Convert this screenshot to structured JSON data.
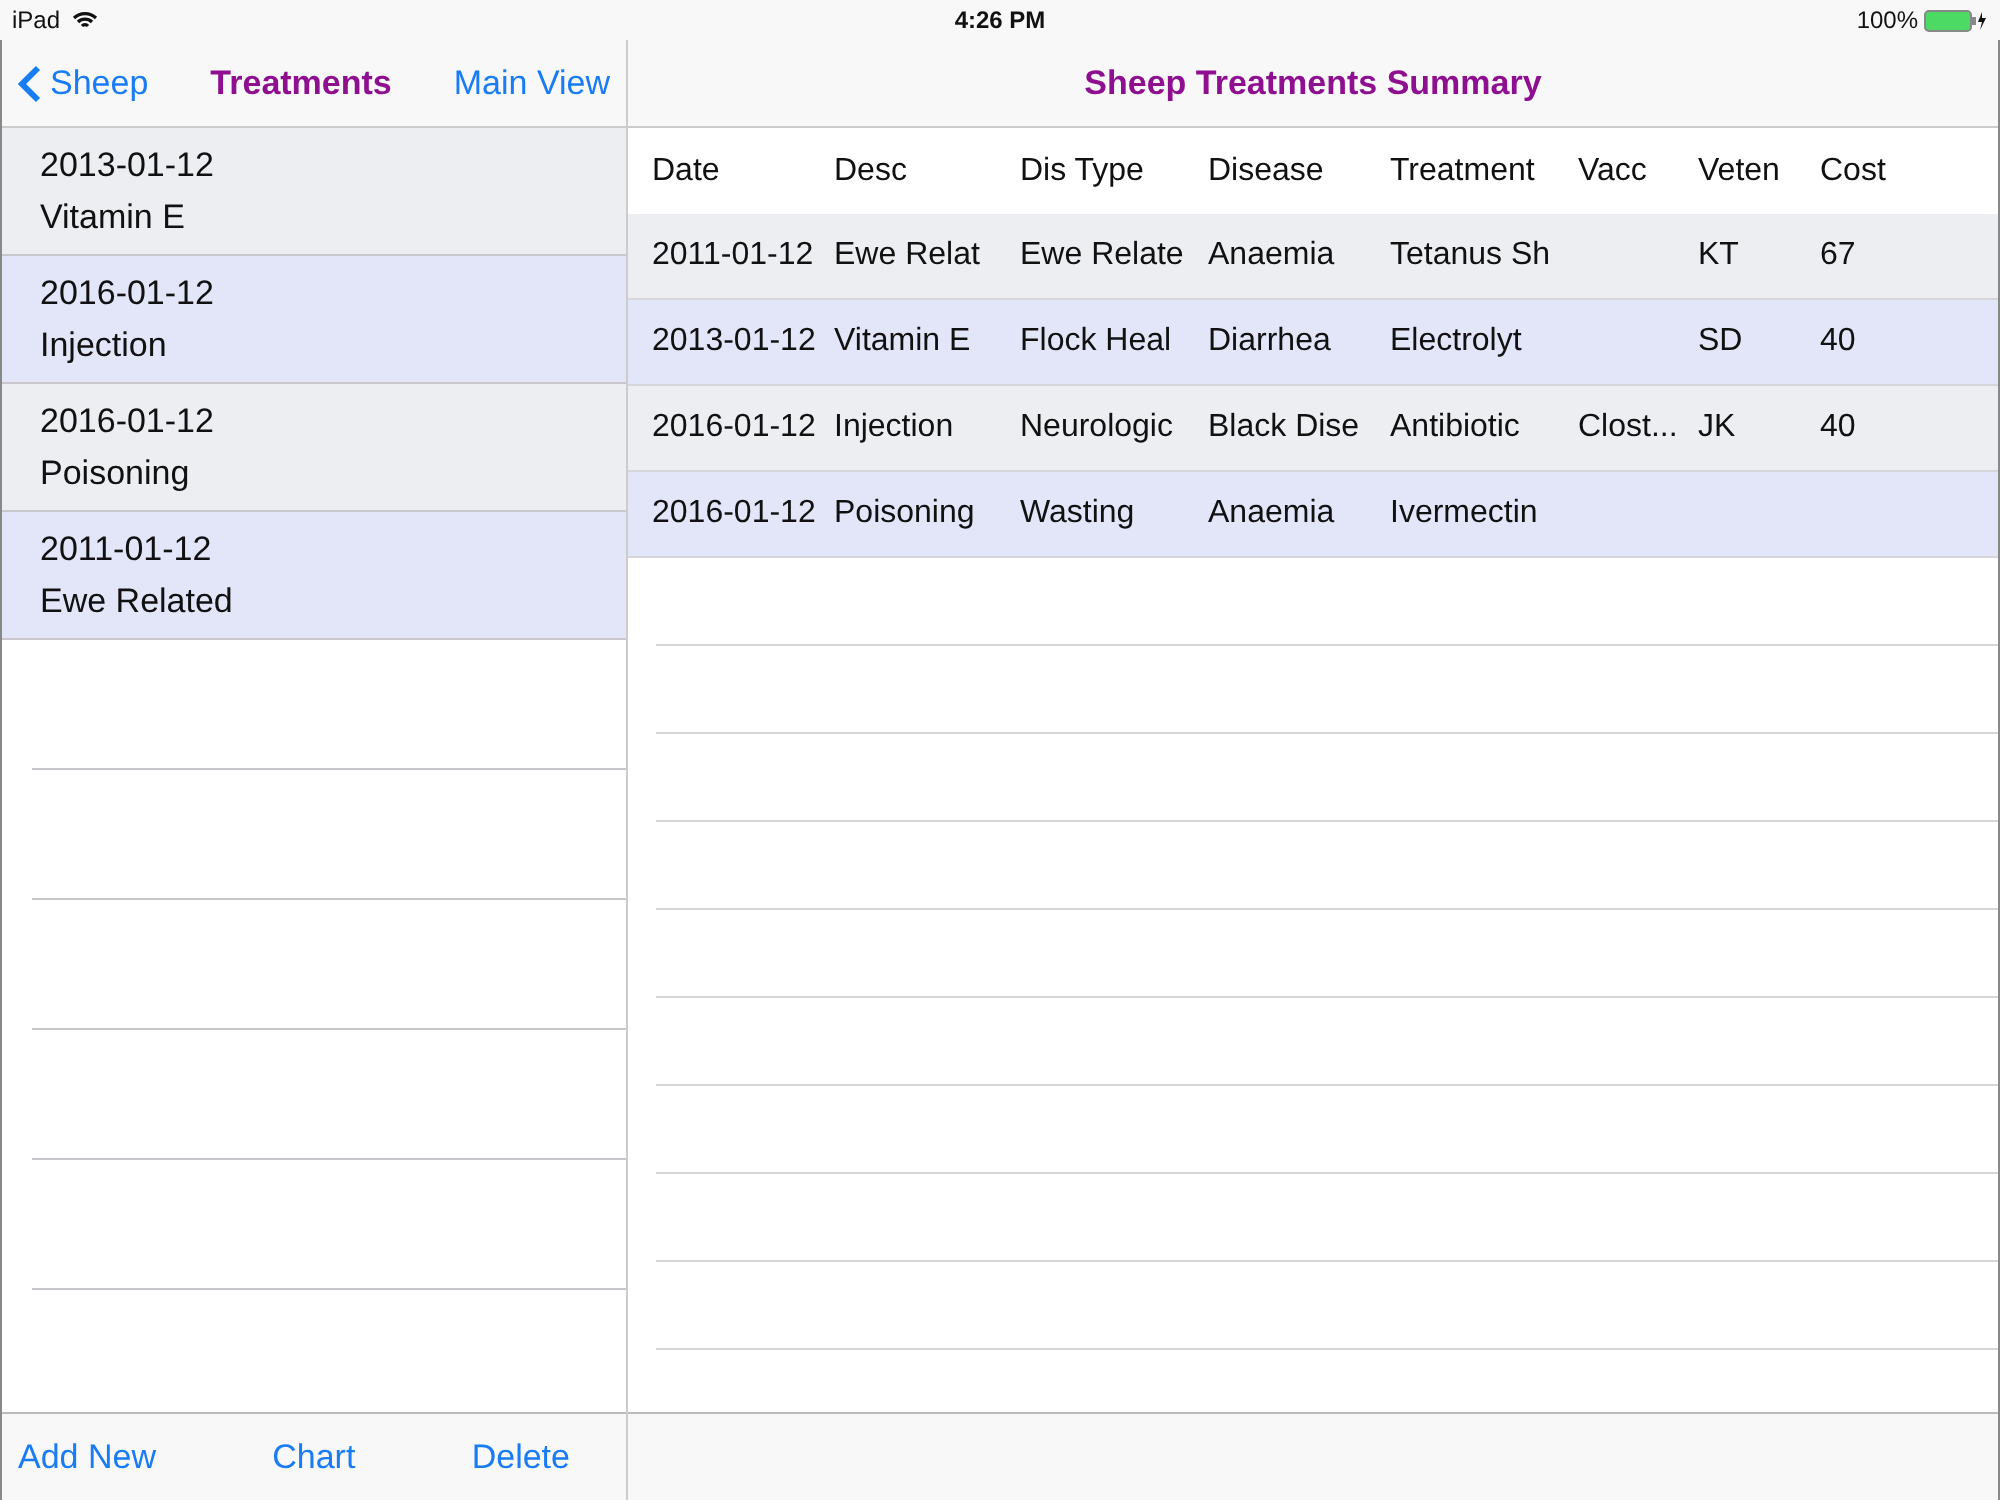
{
  "status_bar": {
    "device": "iPad",
    "time": "4:26 PM",
    "battery": "100%"
  },
  "left_nav": {
    "back": "Sheep",
    "title": "Treatments",
    "action": "Main View"
  },
  "list": [
    {
      "date": "2013-01-12",
      "name": "Vitamin E"
    },
    {
      "date": "2016-01-12",
      "name": "Injection"
    },
    {
      "date": "2016-01-12",
      "name": "Poisoning"
    },
    {
      "date": "2011-01-12",
      "name": "Ewe Related"
    }
  ],
  "left_toolbar": [
    "Add New",
    "Chart",
    "Delete"
  ],
  "right_nav": {
    "title": "Sheep Treatments Summary"
  },
  "table": {
    "columns": [
      "Date",
      "Desc",
      "Dis Type",
      "Disease",
      "Treatment",
      "Vacc",
      "Veten",
      "Cost"
    ],
    "rows": [
      [
        "2011-01-12",
        "Ewe Relat",
        "Ewe Relate",
        "Anaemia",
        "Tetanus Sh",
        "",
        "KT",
        "67"
      ],
      [
        "2013-01-12",
        "Vitamin E",
        "Flock Heal",
        "Diarrhea",
        "Electrolyt",
        "",
        "SD",
        "40"
      ],
      [
        "2016-01-12",
        "Injection",
        "Neurologic",
        "Black Dise",
        "Antibiotic",
        "Clost...",
        "JK",
        "40"
      ],
      [
        "2016-01-12",
        "Poisoning",
        "Wasting",
        "Anaemia",
        "Ivermectin",
        "",
        "",
        ""
      ]
    ]
  }
}
